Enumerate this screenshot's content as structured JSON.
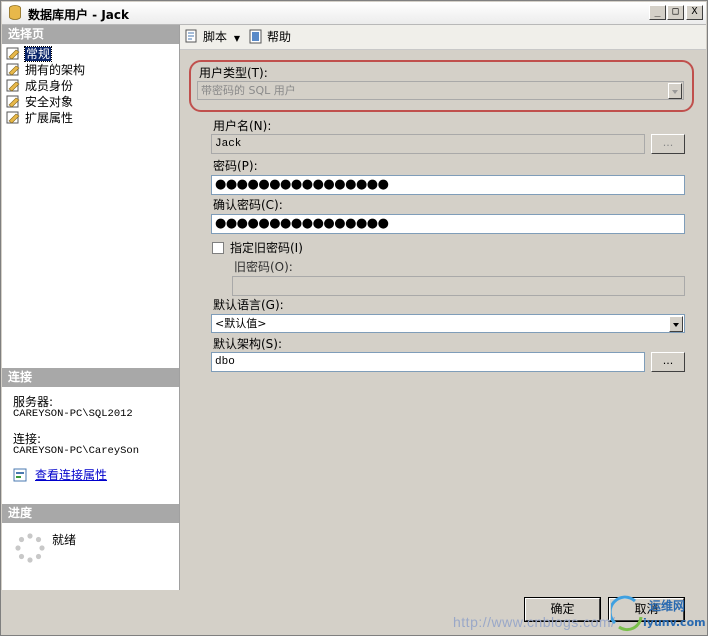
{
  "window": {
    "title": "数据库用户 - Jack"
  },
  "titlebar_buttons": [
    "_",
    "□",
    "X"
  ],
  "left_panel": {
    "select_page_header": "选择页",
    "nav_items": [
      "常规",
      "拥有的架构",
      "成员身份",
      "安全对象",
      "扩展属性"
    ],
    "selected_index": 0,
    "connection_header": "连接",
    "server_label": "服务器:",
    "server_value": "CAREYSON-PC\\SQL2012",
    "connection_label": "连接:",
    "connection_value": "CAREYSON-PC\\CareySon",
    "view_connection_link": "查看连接属性",
    "progress_header": "进度",
    "progress_status": "就绪"
  },
  "toolbar": {
    "script_label": "脚本",
    "help_label": "帮助"
  },
  "form": {
    "user_type_label": "用户类型(T):",
    "user_type_value": "带密码的 SQL 用户",
    "username_label": "用户名(N):",
    "username_value": "Jack",
    "password_label": "密码(P):",
    "password_value": "●●●●●●●●●●●●●●●●",
    "confirm_label": "确认密码(C):",
    "confirm_value": "●●●●●●●●●●●●●●●●",
    "specify_old_label": "指定旧密码(I)",
    "old_password_label": "旧密码(O):",
    "default_language_label": "默认语言(G):",
    "default_language_value": "<默认值>",
    "default_schema_label": "默认架构(S):",
    "default_schema_value": "dbo",
    "browse_button": "..."
  },
  "buttons": {
    "ok": "确定",
    "cancel": "取消"
  },
  "watermark": {
    "url": "http://www.cnblogs.com/",
    "logo_text": "运维网",
    "logo_sub": "iyunv.com"
  },
  "colors": {
    "highlight": "#c0504d",
    "selected": "#0a246a",
    "link": "#0000cc"
  }
}
